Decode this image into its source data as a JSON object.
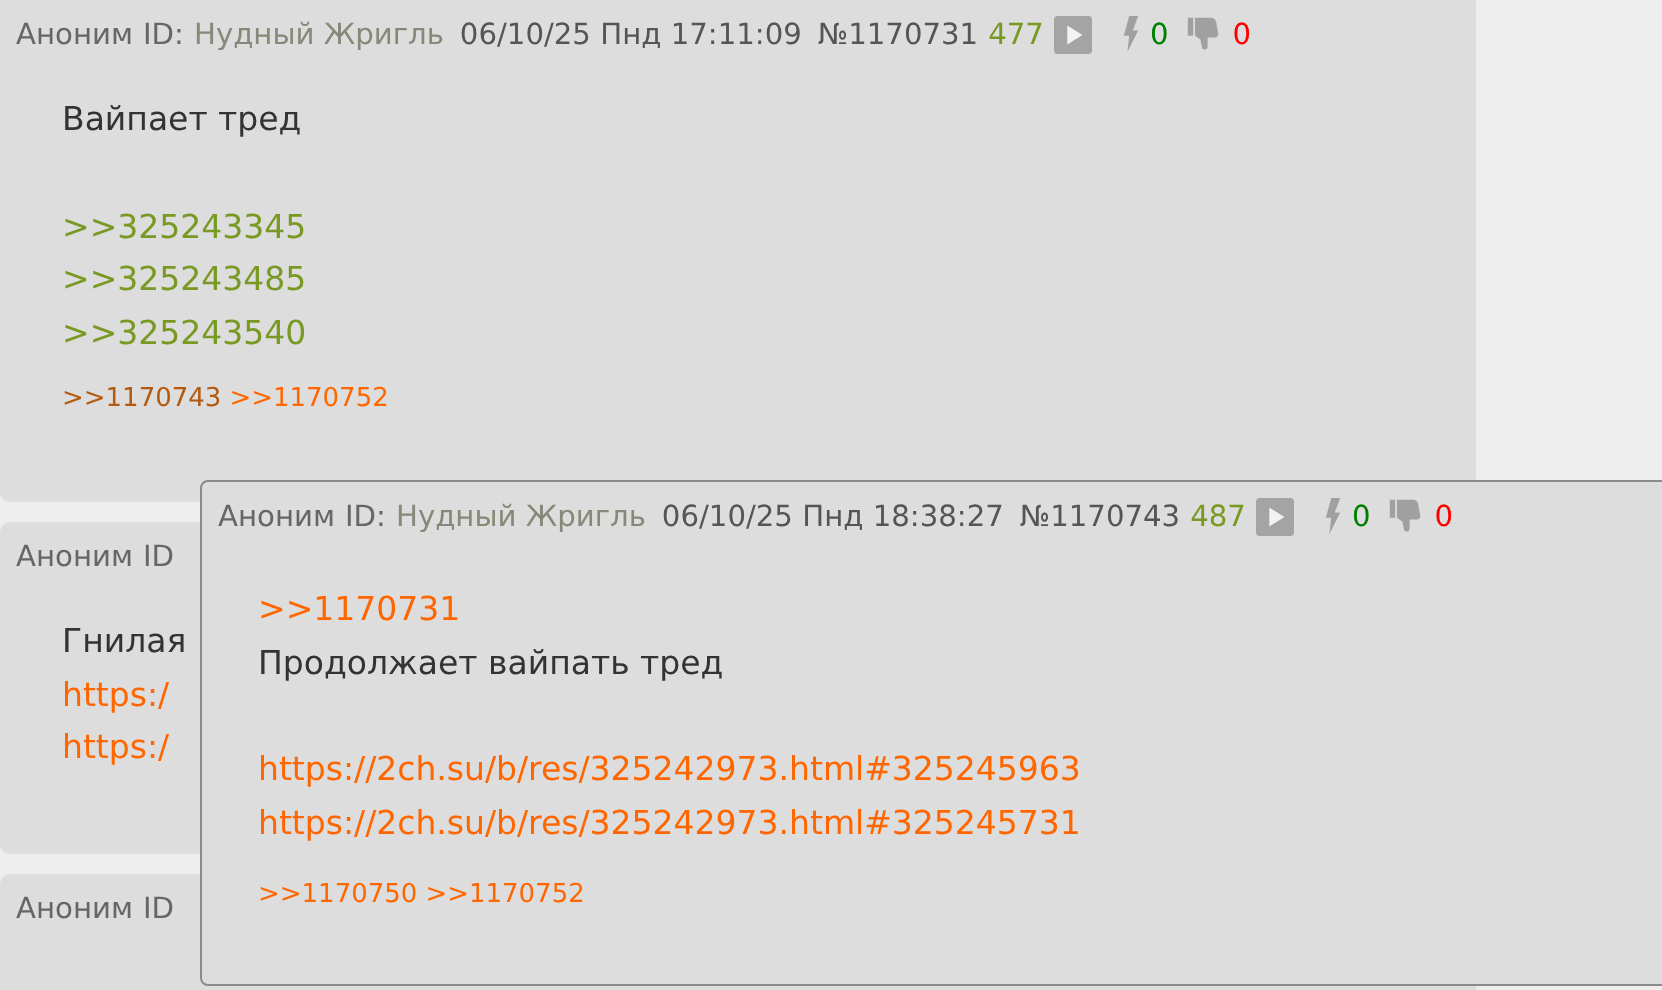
{
  "posts": [
    {
      "header": {
        "name": "Аноним",
        "id_label": "ID:",
        "poster": "Нудный Жригль",
        "date": "06/10/25 Пнд 17:11:09",
        "number": "№1170731",
        "score": "477",
        "likes": "0",
        "dislikes": "0"
      },
      "body": [
        [
          {
            "kind": "text",
            "text": "Вайпает тред"
          }
        ],
        [
          {
            "kind": "greentext",
            "text": ">>325243345"
          },
          {
            "kind": "greentext",
            "text": ">>325243485"
          },
          {
            "kind": "greentext",
            "text": ">>325243540"
          }
        ]
      ],
      "backlinks": [
        {
          "text": ">>1170743",
          "visited": true
        },
        {
          "text": ">>1170752",
          "visited": false
        }
      ]
    },
    {
      "header": {
        "name": "Аноним",
        "id_label": "ID"
      },
      "body": [
        [
          {
            "kind": "text",
            "text": "Гнилая"
          },
          {
            "kind": "link",
            "text": "https:/"
          },
          {
            "kind": "link",
            "text": "https:/"
          }
        ]
      ]
    },
    {
      "header": {
        "name": "Аноним",
        "id_label": "ID"
      }
    }
  ],
  "popup": {
    "header": {
      "name": "Аноним",
      "id_label": "ID:",
      "poster": "Нудный Жригль",
      "date": "06/10/25 Пнд 18:38:27",
      "number": "№1170743",
      "score": "487",
      "likes": "0",
      "dislikes": "0"
    },
    "body": [
      [
        {
          "kind": "link",
          "text": ">>1170731"
        },
        {
          "kind": "text",
          "text": "Продолжает вайпать тред"
        }
      ],
      [
        {
          "kind": "link",
          "text": "https://2ch.su/b/res/325242973.html#325245963"
        },
        {
          "kind": "link",
          "text": "https://2ch.su/b/res/325242973.html#325245731"
        }
      ]
    ],
    "backlinks": [
      {
        "text": ">>1170750",
        "visited": false
      },
      {
        "text": ">>1170752",
        "visited": false
      }
    ]
  }
}
